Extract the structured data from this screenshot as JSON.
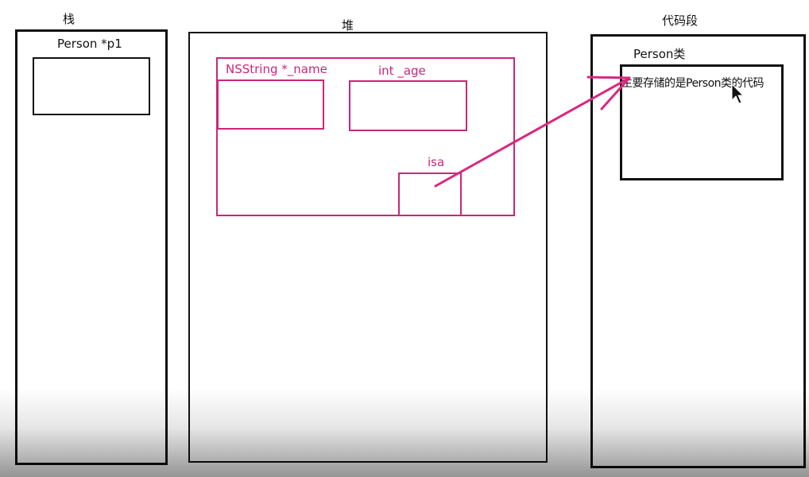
{
  "colors": {
    "ink": "#111111",
    "accent": "#c9267a"
  },
  "stack": {
    "title": "栈",
    "variable_label": "Person *p1"
  },
  "heap": {
    "title": "堆",
    "name_field_label": "NSString *_name",
    "age_field_label": "int _age",
    "isa_label": "isa"
  },
  "code_segment": {
    "title": "代码段",
    "class_label": "Person类",
    "class_description": "主要存储的是Person类的代码"
  },
  "icons": {
    "cursor": "mouse-pointer-icon"
  }
}
